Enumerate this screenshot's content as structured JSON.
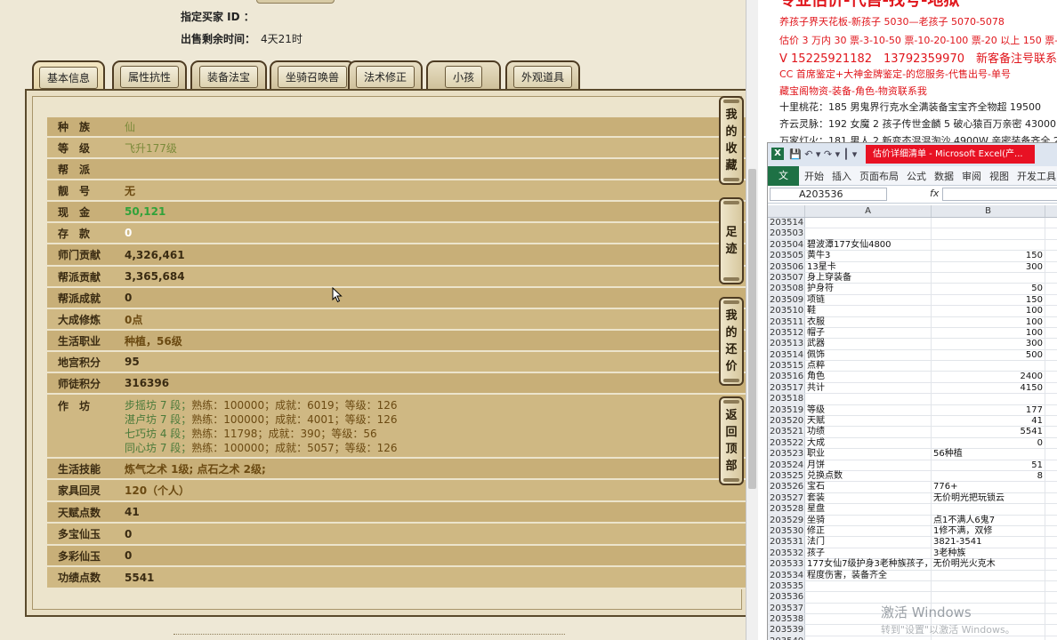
{
  "game": {
    "buyer_label": "指定买家 ID ：",
    "time_label": "出售剩余时间：",
    "time_value": "4天21时",
    "tabs": [
      {
        "label": "基本信息",
        "active": true
      },
      {
        "label": "属性抗性",
        "active": false
      },
      {
        "label": "装备法宝",
        "active": false
      },
      {
        "label": "坐骑召唤兽",
        "active": false
      },
      {
        "label": "法术修正",
        "active": false
      },
      {
        "label": "小孩",
        "active": false
      },
      {
        "label": "外观道具",
        "active": false
      }
    ],
    "rows": [
      {
        "k": "种　族",
        "v": "仙",
        "style": "olive"
      },
      {
        "k": "等　级",
        "v": "飞升177级",
        "style": "olive"
      },
      {
        "k": "帮　派",
        "v": "",
        "style": "olive"
      },
      {
        "k": "靓　号",
        "v": "无",
        "style": "brown"
      },
      {
        "k": "现　金",
        "v": "50,121",
        "style": "green"
      },
      {
        "k": "存　款",
        "v": "0",
        "style": "white"
      },
      {
        "k": "师门贡献",
        "v": "4,326,461",
        "style": "dark"
      },
      {
        "k": "帮派贡献",
        "v": "3,365,684",
        "style": "dark"
      },
      {
        "k": "帮派成就",
        "v": "0",
        "style": "dark"
      },
      {
        "k": "大成修炼",
        "v": "0点",
        "style": "brown"
      },
      {
        "k": "生活职业",
        "v": "种植，56级",
        "style": "brown"
      },
      {
        "k": "地宫积分",
        "v": "95",
        "style": "dark"
      },
      {
        "k": "师徒积分",
        "v": "316396",
        "style": "dark"
      }
    ],
    "craft_label": "作　坊",
    "crafts": [
      {
        "name": "步摇坊 7 段；",
        "rest": "熟练：100000；成就：6019；等级：126"
      },
      {
        "name": "湛卢坊 7 段；",
        "rest": "熟练：100000；成就：4001；等级：126"
      },
      {
        "name": "七巧坊 4 段；",
        "rest": "熟练：11798；成就：390；等级：56"
      },
      {
        "name": "同心坊 7 段；",
        "rest": "熟练：100000；成就：5057；等级：126"
      }
    ],
    "rows2": [
      {
        "k": "生活技能",
        "v": "炼气之术 1级; 点石之术 2级;",
        "style": "brown"
      },
      {
        "k": "家具回灵",
        "v": "120（个人）",
        "style": "brown"
      },
      {
        "k": "天赋点数",
        "v": "41",
        "style": "dark"
      },
      {
        "k": "多宝仙玉",
        "v": "0",
        "style": "dark"
      },
      {
        "k": "多彩仙玉",
        "v": "0",
        "style": "dark"
      },
      {
        "k": "功绩点数",
        "v": "5541",
        "style": "dark"
      }
    ],
    "side_buttons": [
      {
        "label": "我的收藏",
        "chars": [
          "我",
          "的",
          "收",
          "藏"
        ]
      },
      {
        "label": "足迹",
        "chars": [
          "足",
          "迹"
        ]
      },
      {
        "label": "我的还价",
        "chars": [
          "我",
          "的",
          "还",
          "价"
        ]
      },
      {
        "label": "返回顶部",
        "chars": [
          "返",
          "回",
          "顶",
          "部"
        ]
      }
    ]
  },
  "ads": {
    "top_partial": "专业估价-代售-找号-地狱",
    "lines": [
      {
        "text": "养孩子界天花板-新孩子 5030—老孩子 5070-5078",
        "style": "red"
      },
      {
        "text": "估价 3 万内 30 票-3-10-50 票-10-20-100 票-20 以上 150 票-1 票",
        "style": "red"
      },
      {
        "text": "V 15225921182　13792359970　新客备注号联系",
        "style": "red-big"
      },
      {
        "text": "CC 首席鉴定+大神金牌鉴定-的您服务-代售出号-单号",
        "style": "red"
      },
      {
        "text": "藏宝阁物资-装备-角色-物资联系我",
        "style": "red"
      },
      {
        "text": "十里桃花：185 男鬼界行克水全满装备宝宝齐全物超 19500",
        "style": "black"
      },
      {
        "text": "齐云灵脉：192 女魔 2 孩子传世金麟 5 破心猿百万亲密 43000",
        "style": "black"
      },
      {
        "text": "万家灯火：181 男人 2 新变态混混淘沙 4900W 亲密装备齐全 2300",
        "style": "black"
      }
    ]
  },
  "excel": {
    "app_icon": "X",
    "title": "估价详细清单 - Microsoft Excel(产...",
    "ribbon_file": "文件",
    "ribbon_tabs": [
      "开始",
      "插入",
      "页面布局",
      "公式",
      "数据",
      "审阅",
      "视图",
      "开发工具"
    ],
    "name_box": "A203536",
    "fx": "fx",
    "col_headers": [
      "",
      "A",
      "B"
    ],
    "rows": [
      {
        "n": "203514",
        "a": "",
        "b": "",
        "bt": "num"
      },
      {
        "n": "203503",
        "a": "",
        "b": "",
        "bt": "num"
      },
      {
        "n": "203504",
        "a": "碧波潭177女仙4800",
        "b": "",
        "bt": "num"
      },
      {
        "n": "203505",
        "a": "黄牛3",
        "b": "150",
        "bt": "num"
      },
      {
        "n": "203506",
        "a": "13星卡",
        "b": "300",
        "bt": "num"
      },
      {
        "n": "203507",
        "a": "身上穿装备",
        "b": "",
        "bt": "num"
      },
      {
        "n": "203508",
        "a": "护身符",
        "b": "50",
        "bt": "num"
      },
      {
        "n": "203509",
        "a": "项链",
        "b": "150",
        "bt": "num"
      },
      {
        "n": "203510",
        "a": "鞋",
        "b": "100",
        "bt": "num"
      },
      {
        "n": "203511",
        "a": "衣服",
        "b": "100",
        "bt": "num"
      },
      {
        "n": "203512",
        "a": "帽子",
        "b": "100",
        "bt": "num"
      },
      {
        "n": "203513",
        "a": "武器",
        "b": "300",
        "bt": "num"
      },
      {
        "n": "203514",
        "a": "佩饰",
        "b": "500",
        "bt": "num"
      },
      {
        "n": "203515",
        "a": "点粹",
        "b": "",
        "bt": "num"
      },
      {
        "n": "203516",
        "a": "角色",
        "b": "2400",
        "bt": "num"
      },
      {
        "n": "203517",
        "a": "共计",
        "b": "4150",
        "bt": "num"
      },
      {
        "n": "203518",
        "a": "",
        "b": "",
        "bt": "num"
      },
      {
        "n": "203519",
        "a": "等级",
        "b": "177",
        "bt": "num"
      },
      {
        "n": "203520",
        "a": "天赋",
        "b": "41",
        "bt": "num"
      },
      {
        "n": "203521",
        "a": "功绩",
        "b": "5541",
        "bt": "num"
      },
      {
        "n": "203522",
        "a": "大成",
        "b": "0",
        "bt": "num"
      },
      {
        "n": "203523",
        "a": "职业",
        "b": "56种植",
        "bt": "txt"
      },
      {
        "n": "203524",
        "a": "月饼",
        "b": "51",
        "bt": "num"
      },
      {
        "n": "203525",
        "a": "兑换点数",
        "b": "8",
        "bt": "num"
      },
      {
        "n": "203526",
        "a": "宝石",
        "b": "776+",
        "bt": "txt"
      },
      {
        "n": "203527",
        "a": "套装",
        "b": "无价明光把玩锁云",
        "bt": "txt"
      },
      {
        "n": "203528",
        "a": "星盘",
        "b": "",
        "bt": "txt"
      },
      {
        "n": "203529",
        "a": "坐骑",
        "b": "点1不满人6鬼7",
        "bt": "txt"
      },
      {
        "n": "203530",
        "a": "修正",
        "b": "1修不满，双修",
        "bt": "txt"
      },
      {
        "n": "203531",
        "a": "法门",
        "b": "3821-3541",
        "bt": "txt"
      },
      {
        "n": "203532",
        "a": "孩子",
        "b": "3老种族",
        "bt": "txt"
      },
      {
        "n": "203533",
        "a": "177女仙7级护身3老种族孩子，无价明光火克木",
        "b": "",
        "bt": "txt"
      },
      {
        "n": "203534",
        "a": "程度伤害，装备齐全",
        "b": "",
        "bt": "txt"
      },
      {
        "n": "203535",
        "a": "",
        "b": "",
        "bt": "txt"
      },
      {
        "n": "203536",
        "a": "",
        "b": "",
        "bt": "txt"
      },
      {
        "n": "203537",
        "a": "",
        "b": "",
        "bt": "txt"
      },
      {
        "n": "203538",
        "a": "",
        "b": "",
        "bt": "txt"
      },
      {
        "n": "203539",
        "a": "",
        "b": "",
        "bt": "txt"
      },
      {
        "n": "203540",
        "a": "",
        "b": "",
        "bt": "txt"
      }
    ]
  },
  "watermark": {
    "line1": "激活 Windows",
    "line2": "转到\"设置\"以激活 Windows。"
  }
}
